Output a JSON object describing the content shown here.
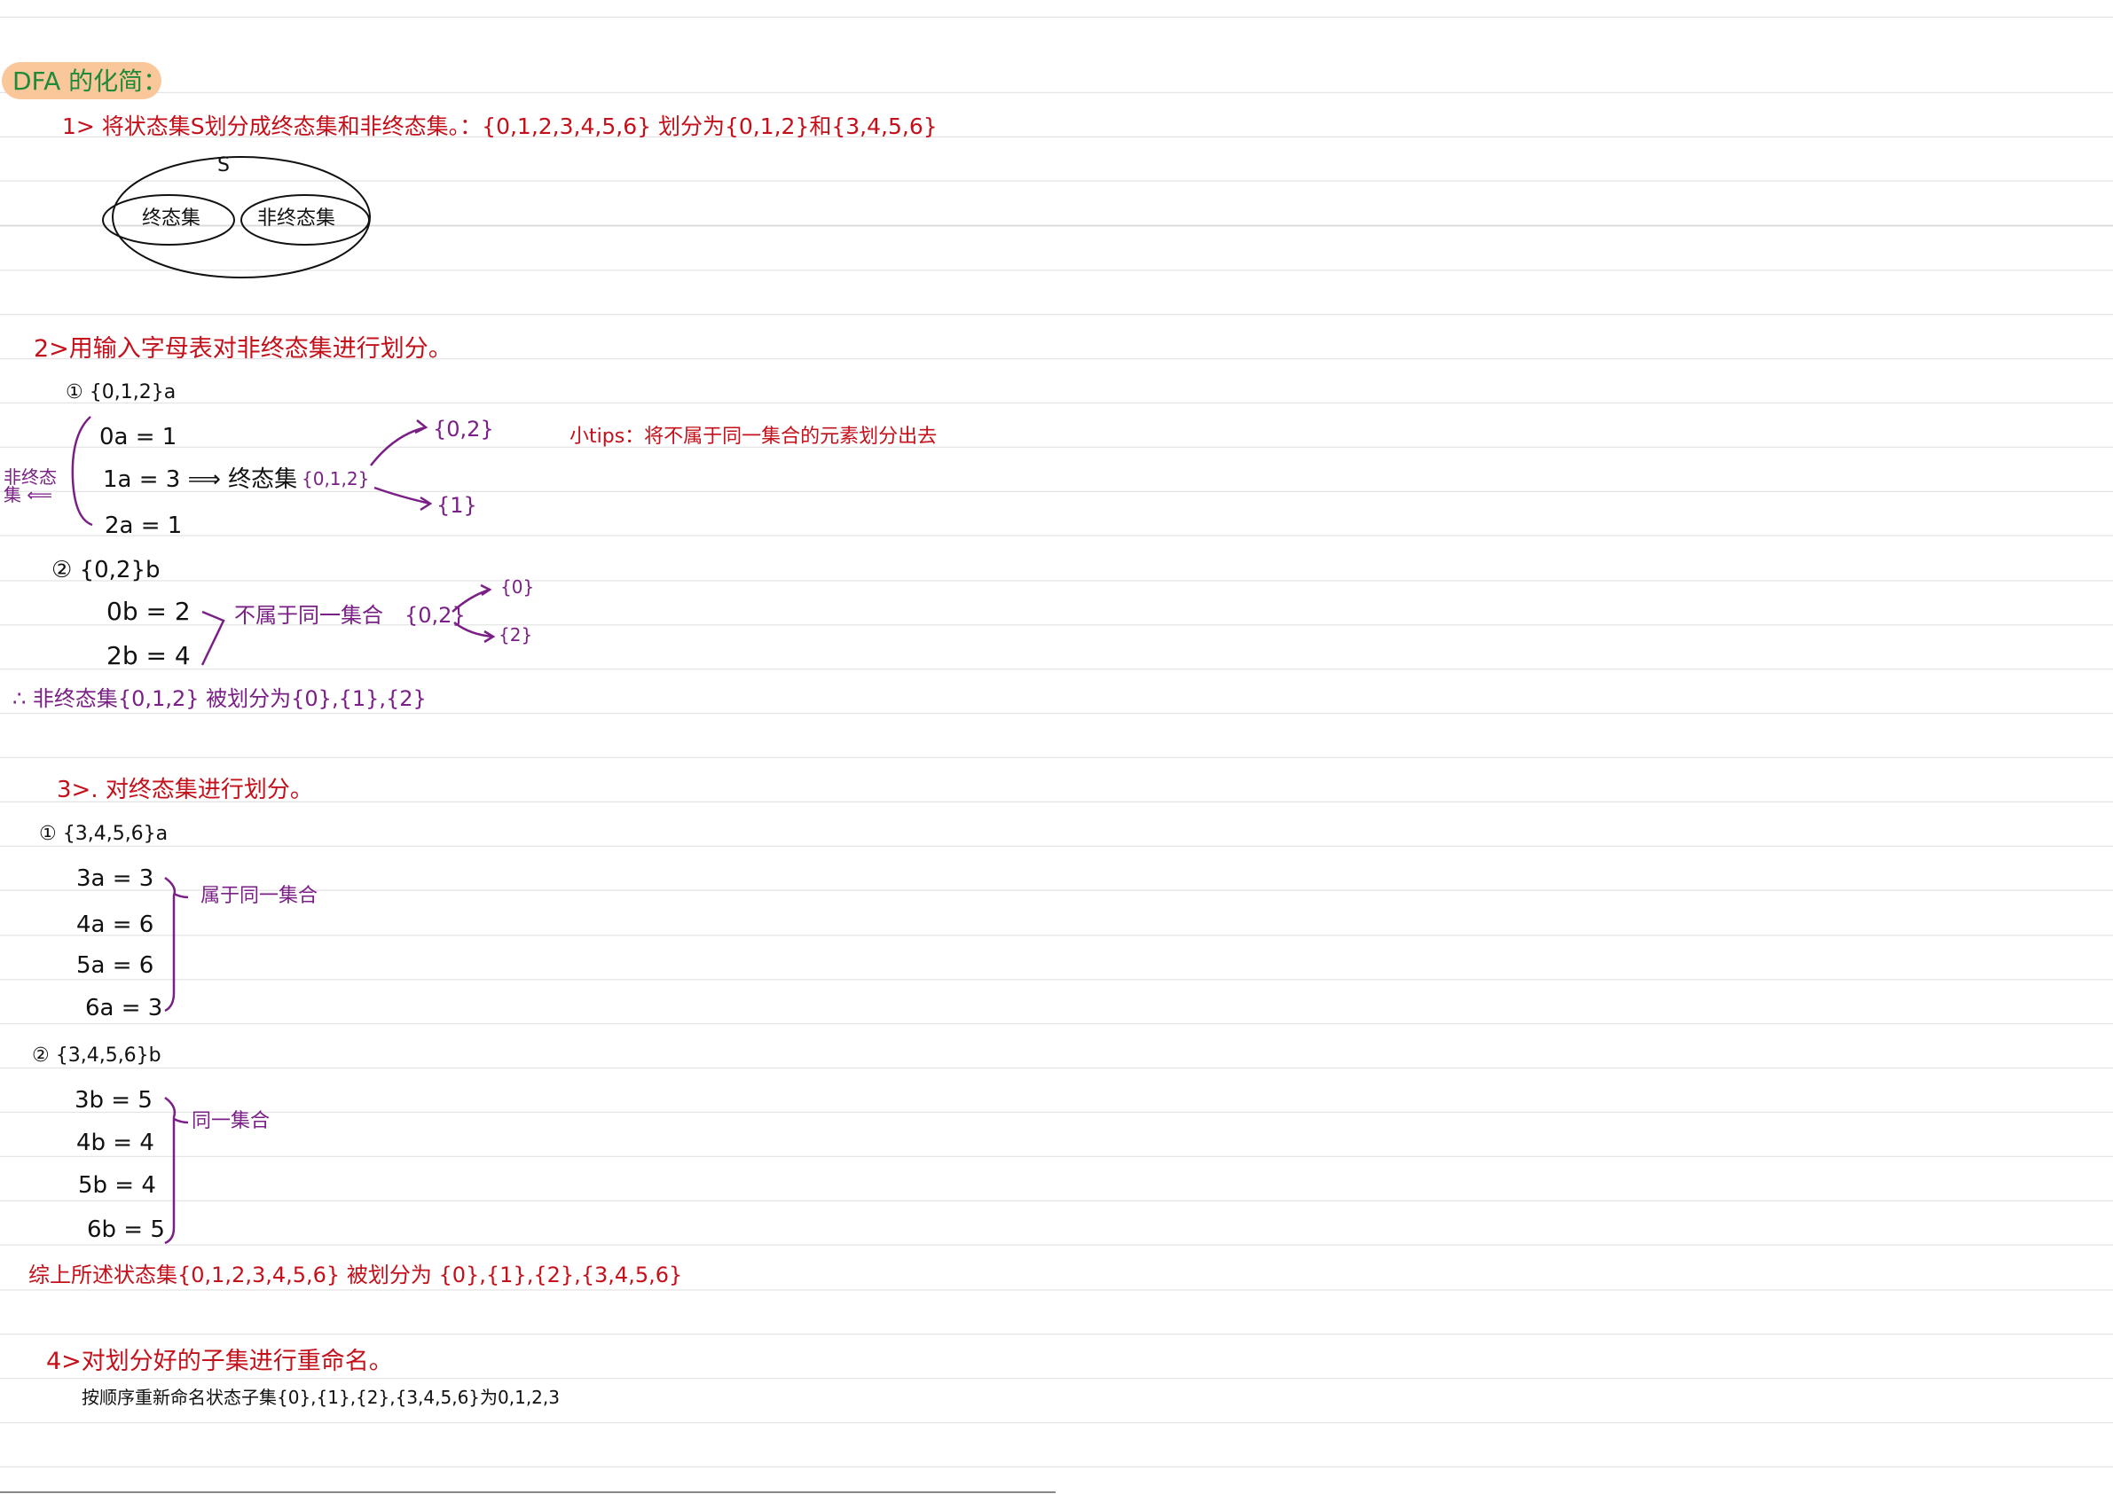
{
  "title": "DFA 的化简：",
  "step1": {
    "text": "1> 将状态集S划分成终态集和非终态集。：{0,1,2,3,4,5,6} 划分为{0,1,2}和{3,4,5,6}",
    "diagram": {
      "outer": "S",
      "left": "终态集",
      "right": "非终态集"
    }
  },
  "step2": {
    "heading": "2>用输入字母表对非终态集进行划分。",
    "part1": {
      "label": "① {0,1,2}a",
      "lines": [
        "0a = 1",
        "1a = 3 ⟹ 终态集",
        "2a = 1"
      ],
      "side_label": "非终态集 ⟸",
      "split_from": "{0,1,2}",
      "split_to": [
        "{0,2}",
        "{1}"
      ],
      "tips": "小tips：将不属于同一集合的元素划分出去"
    },
    "part2": {
      "label": "② {0,2}b",
      "lines": [
        "0b = 2",
        "2b = 4"
      ],
      "note": "不属于同一集合",
      "split_from": "{0,2}",
      "split_to": [
        "{0}",
        "{2}"
      ]
    },
    "conclusion": "∴ 非终态集{0,1,2} 被划分为{0},{1},{2}"
  },
  "step3": {
    "heading": "3>. 对终态集进行划分。",
    "part1": {
      "label": "① {3,4,5,6}a",
      "lines": [
        "3a = 3",
        "4a = 6",
        "5a = 6",
        "6a = 3"
      ],
      "note": "属于同一集合"
    },
    "part2": {
      "label": "② {3,4,5,6}b",
      "lines": [
        "3b = 5",
        "4b = 4",
        "5b = 4",
        "6b = 5"
      ],
      "note": "同一集合"
    },
    "conclusion": "综上所述状态集{0,1,2,3,4,5,6} 被划分为 {0},{1},{2},{3,4,5,6}"
  },
  "step4": {
    "heading": "4>对划分好的子集进行重命名。",
    "text": "按顺序重新命名状态子集{0},{1},{2},{3,4,5,6}为0,1,2,3"
  }
}
